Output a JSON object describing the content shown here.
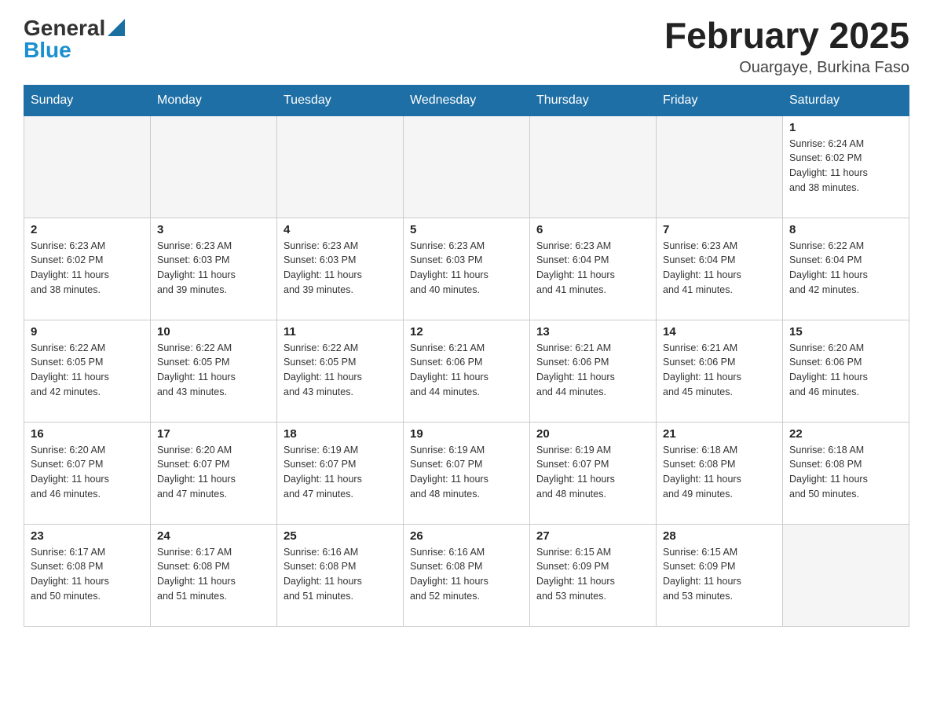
{
  "logo": {
    "text_general": "General",
    "text_blue": "Blue"
  },
  "header": {
    "month_year": "February 2025",
    "location": "Ouargaye, Burkina Faso"
  },
  "weekdays": [
    "Sunday",
    "Monday",
    "Tuesday",
    "Wednesday",
    "Thursday",
    "Friday",
    "Saturday"
  ],
  "weeks": [
    [
      {
        "day": "",
        "info": ""
      },
      {
        "day": "",
        "info": ""
      },
      {
        "day": "",
        "info": ""
      },
      {
        "day": "",
        "info": ""
      },
      {
        "day": "",
        "info": ""
      },
      {
        "day": "",
        "info": ""
      },
      {
        "day": "1",
        "info": "Sunrise: 6:24 AM\nSunset: 6:02 PM\nDaylight: 11 hours\nand 38 minutes."
      }
    ],
    [
      {
        "day": "2",
        "info": "Sunrise: 6:23 AM\nSunset: 6:02 PM\nDaylight: 11 hours\nand 38 minutes."
      },
      {
        "day": "3",
        "info": "Sunrise: 6:23 AM\nSunset: 6:03 PM\nDaylight: 11 hours\nand 39 minutes."
      },
      {
        "day": "4",
        "info": "Sunrise: 6:23 AM\nSunset: 6:03 PM\nDaylight: 11 hours\nand 39 minutes."
      },
      {
        "day": "5",
        "info": "Sunrise: 6:23 AM\nSunset: 6:03 PM\nDaylight: 11 hours\nand 40 minutes."
      },
      {
        "day": "6",
        "info": "Sunrise: 6:23 AM\nSunset: 6:04 PM\nDaylight: 11 hours\nand 41 minutes."
      },
      {
        "day": "7",
        "info": "Sunrise: 6:23 AM\nSunset: 6:04 PM\nDaylight: 11 hours\nand 41 minutes."
      },
      {
        "day": "8",
        "info": "Sunrise: 6:22 AM\nSunset: 6:04 PM\nDaylight: 11 hours\nand 42 minutes."
      }
    ],
    [
      {
        "day": "9",
        "info": "Sunrise: 6:22 AM\nSunset: 6:05 PM\nDaylight: 11 hours\nand 42 minutes."
      },
      {
        "day": "10",
        "info": "Sunrise: 6:22 AM\nSunset: 6:05 PM\nDaylight: 11 hours\nand 43 minutes."
      },
      {
        "day": "11",
        "info": "Sunrise: 6:22 AM\nSunset: 6:05 PM\nDaylight: 11 hours\nand 43 minutes."
      },
      {
        "day": "12",
        "info": "Sunrise: 6:21 AM\nSunset: 6:06 PM\nDaylight: 11 hours\nand 44 minutes."
      },
      {
        "day": "13",
        "info": "Sunrise: 6:21 AM\nSunset: 6:06 PM\nDaylight: 11 hours\nand 44 minutes."
      },
      {
        "day": "14",
        "info": "Sunrise: 6:21 AM\nSunset: 6:06 PM\nDaylight: 11 hours\nand 45 minutes."
      },
      {
        "day": "15",
        "info": "Sunrise: 6:20 AM\nSunset: 6:06 PM\nDaylight: 11 hours\nand 46 minutes."
      }
    ],
    [
      {
        "day": "16",
        "info": "Sunrise: 6:20 AM\nSunset: 6:07 PM\nDaylight: 11 hours\nand 46 minutes."
      },
      {
        "day": "17",
        "info": "Sunrise: 6:20 AM\nSunset: 6:07 PM\nDaylight: 11 hours\nand 47 minutes."
      },
      {
        "day": "18",
        "info": "Sunrise: 6:19 AM\nSunset: 6:07 PM\nDaylight: 11 hours\nand 47 minutes."
      },
      {
        "day": "19",
        "info": "Sunrise: 6:19 AM\nSunset: 6:07 PM\nDaylight: 11 hours\nand 48 minutes."
      },
      {
        "day": "20",
        "info": "Sunrise: 6:19 AM\nSunset: 6:07 PM\nDaylight: 11 hours\nand 48 minutes."
      },
      {
        "day": "21",
        "info": "Sunrise: 6:18 AM\nSunset: 6:08 PM\nDaylight: 11 hours\nand 49 minutes."
      },
      {
        "day": "22",
        "info": "Sunrise: 6:18 AM\nSunset: 6:08 PM\nDaylight: 11 hours\nand 50 minutes."
      }
    ],
    [
      {
        "day": "23",
        "info": "Sunrise: 6:17 AM\nSunset: 6:08 PM\nDaylight: 11 hours\nand 50 minutes."
      },
      {
        "day": "24",
        "info": "Sunrise: 6:17 AM\nSunset: 6:08 PM\nDaylight: 11 hours\nand 51 minutes."
      },
      {
        "day": "25",
        "info": "Sunrise: 6:16 AM\nSunset: 6:08 PM\nDaylight: 11 hours\nand 51 minutes."
      },
      {
        "day": "26",
        "info": "Sunrise: 6:16 AM\nSunset: 6:08 PM\nDaylight: 11 hours\nand 52 minutes."
      },
      {
        "day": "27",
        "info": "Sunrise: 6:15 AM\nSunset: 6:09 PM\nDaylight: 11 hours\nand 53 minutes."
      },
      {
        "day": "28",
        "info": "Sunrise: 6:15 AM\nSunset: 6:09 PM\nDaylight: 11 hours\nand 53 minutes."
      },
      {
        "day": "",
        "info": ""
      }
    ]
  ]
}
